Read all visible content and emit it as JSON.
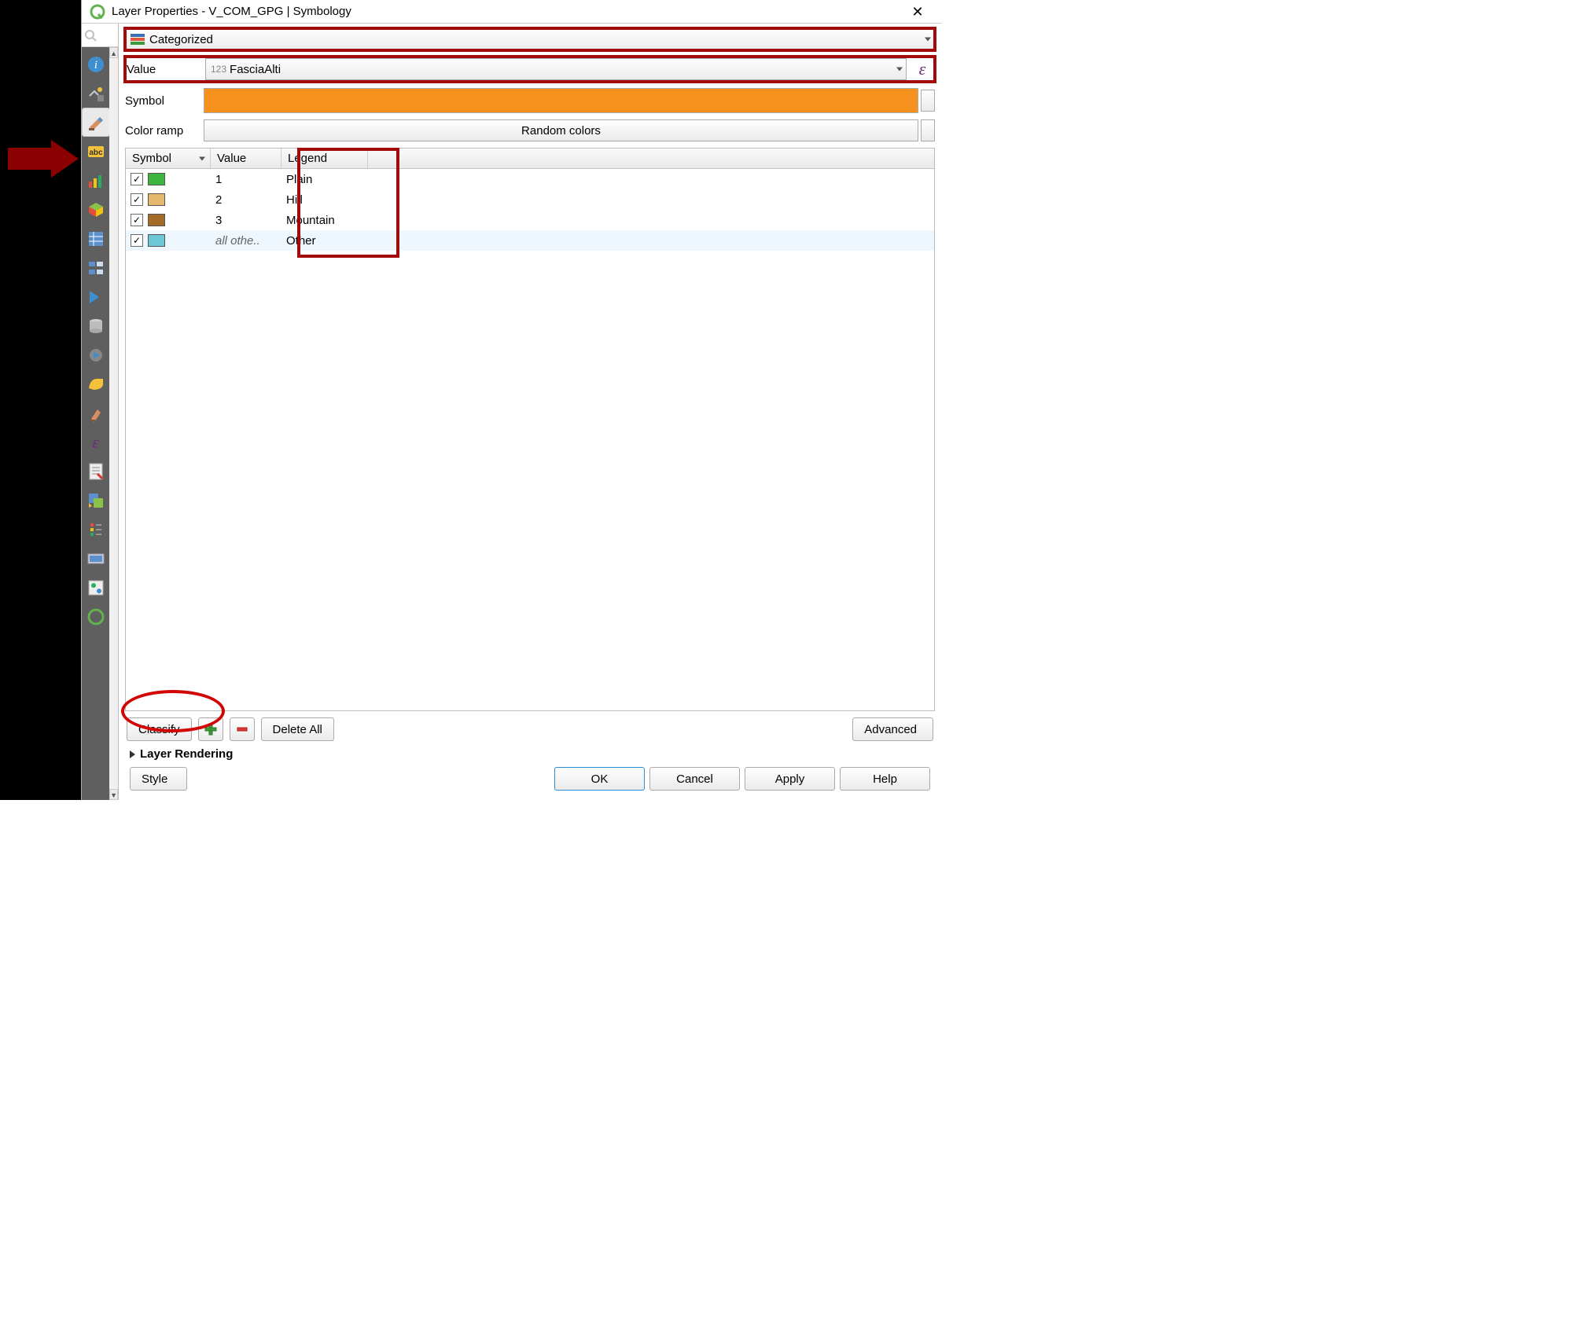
{
  "window": {
    "title": "Layer Properties - V_COM_GPG | Symbology",
    "close": "✕"
  },
  "renderer": {
    "selected": "Categorized"
  },
  "value_field": {
    "label": "Value",
    "prefix": "123",
    "name": "FasciaAlti"
  },
  "symbol": {
    "label": "Symbol",
    "color": "#F7921E"
  },
  "ramp": {
    "label": "Color ramp",
    "selected": "Random colors"
  },
  "columns": {
    "symbol": "Symbol",
    "value": "Value",
    "legend": "Legend"
  },
  "rows": [
    {
      "checked": true,
      "color": "#3BB53B",
      "value": "1",
      "legend": "Plain",
      "italic": false
    },
    {
      "checked": true,
      "color": "#E6B86E",
      "value": "2",
      "legend": "Hill",
      "italic": false
    },
    {
      "checked": true,
      "color": "#A66B2B",
      "value": "3",
      "legend": "Mountain",
      "italic": false
    },
    {
      "checked": true,
      "color": "#6BC7D6",
      "value": "all othe..",
      "legend": "Other",
      "italic": true
    }
  ],
  "buttons": {
    "classify": "Classify",
    "delete_all": "Delete All",
    "advanced": "Advanced",
    "style": "Style",
    "ok": "OK",
    "cancel": "Cancel",
    "apply": "Apply",
    "help": "Help"
  },
  "layer_rendering": "Layer Rendering"
}
